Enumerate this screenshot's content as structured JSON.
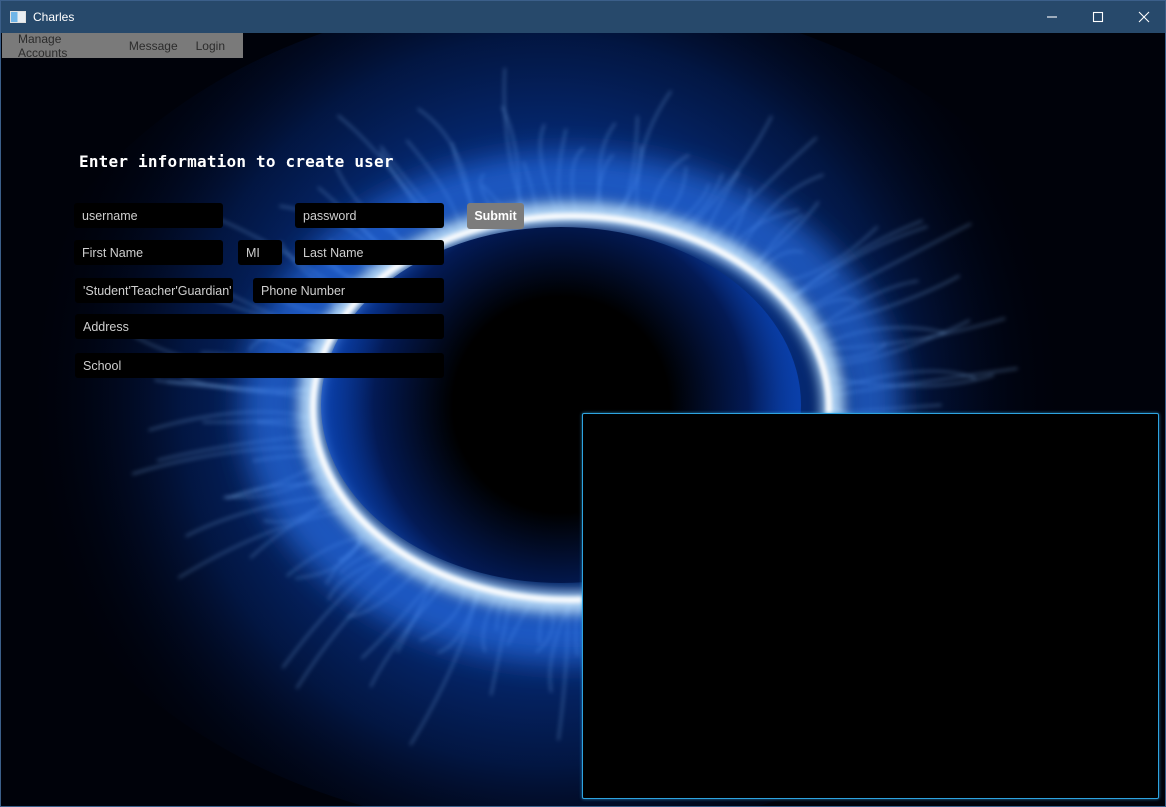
{
  "window": {
    "title": "Charles",
    "controls": [
      "minimize-icon",
      "maximize-icon",
      "close-icon"
    ]
  },
  "menu": {
    "items": [
      "Manage Accounts",
      "Message",
      "Login"
    ]
  },
  "form": {
    "title": "Enter information to create user",
    "username_placeholder": "username",
    "password_placeholder": "password",
    "submit_label": "Submit",
    "first_name_placeholder": "First Name",
    "mi_placeholder": "MI",
    "last_name_placeholder": "Last Name",
    "role_placeholder": "'Student'Teacher'Guardian'",
    "phone_placeholder": "Phone Number",
    "address_placeholder": "Address",
    "school_placeholder": "School"
  },
  "colors": {
    "titlebar": "#27496b",
    "menubar": "#7a7a7a",
    "accent_glow": "#2f8cff",
    "panel_border": "#2ea4e0",
    "submit_bg": "#7c7c7c"
  }
}
